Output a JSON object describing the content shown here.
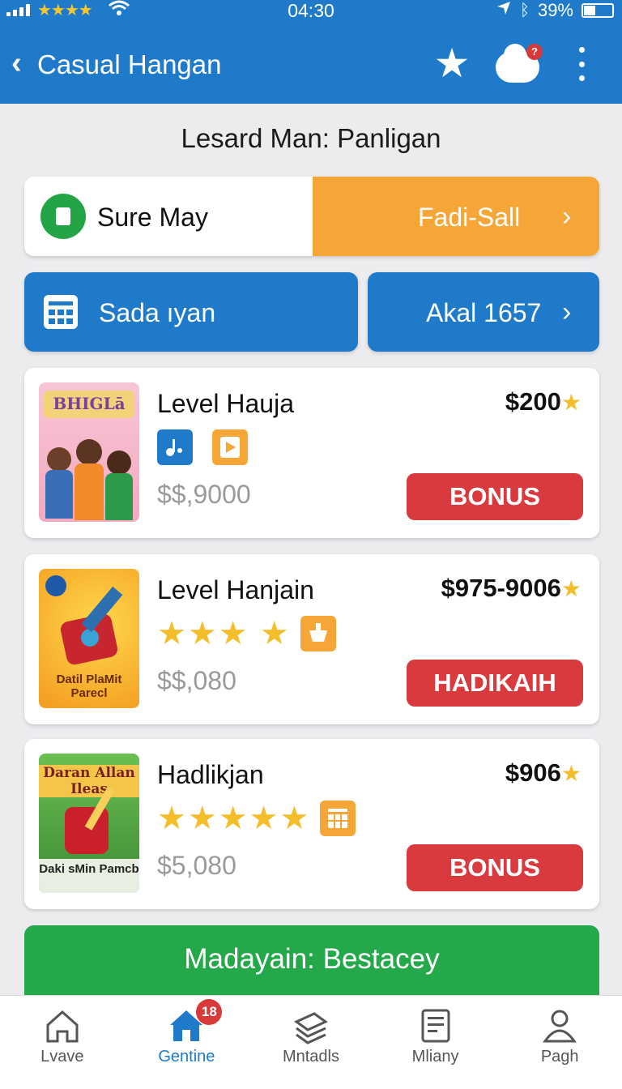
{
  "status_bar": {
    "time": "04:30",
    "battery": "39%",
    "stars": "★★★★"
  },
  "app_bar": {
    "back": "‹",
    "title": "Casual Hangan",
    "notification_dot": "?"
  },
  "subtitle": "Lesard Man: Panligan",
  "row1": {
    "left_label": "Sure May",
    "right_label": "Fadi-Sall"
  },
  "row2": {
    "left_label": "Sada ıyan",
    "right_label": "Akal 1657"
  },
  "games": [
    {
      "thumb_title": "BHIGLā",
      "title": "Level Hauja",
      "price": "$200",
      "subtitle": "$$,9000",
      "button": "BONUS"
    },
    {
      "thumb_title": "Datil PlaMit Parecl",
      "title": "Level Hanjain",
      "price": "$975-9006",
      "subtitle": "$$,080",
      "button": "HADIKAIH",
      "rating_stars": 4
    },
    {
      "thumb_title": "Daran Allan Ileas",
      "thumb_caption": "Daki sMin Pamcb",
      "title": "Hadlikjan",
      "price": "$906",
      "subtitle": "$5,080",
      "button": "BONUS",
      "rating_stars": 5
    }
  ],
  "banner": "Madayain: Bestacey",
  "bottom_nav": [
    {
      "label": "Lvave",
      "icon": "home-icon"
    },
    {
      "label": "Gentine",
      "icon": "home-icon",
      "badge": "18",
      "active": true
    },
    {
      "label": "Mntadls",
      "icon": "layers-icon"
    },
    {
      "label": "Mliany",
      "icon": "document-icon"
    },
    {
      "label": "Pagh",
      "icon": "person-icon"
    }
  ],
  "colors": {
    "primary": "#1f7bc9",
    "orange": "#f5a637",
    "green": "#23a84a",
    "red": "#d83a3d",
    "star": "#f4be2b"
  }
}
